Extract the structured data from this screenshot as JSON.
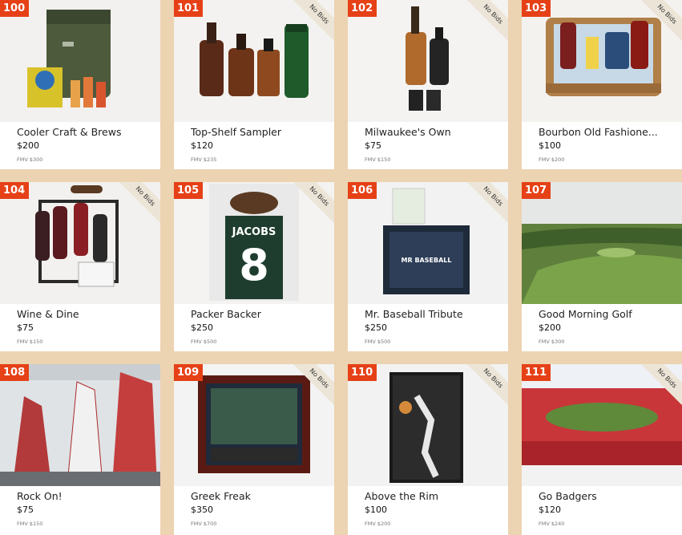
{
  "no_bids_label": "No Bids",
  "items": [
    {
      "lot": "100",
      "title": "Cooler Craft & Brews",
      "price": "$200",
      "fmv": "FMV $300",
      "no_bids": false,
      "icon": "cooler-icon"
    },
    {
      "lot": "101",
      "title": "Top-Shelf Sampler",
      "price": "$120",
      "fmv": "FMV $235",
      "no_bids": true,
      "icon": "bottles-icon"
    },
    {
      "lot": "102",
      "title": "Milwaukee's Own",
      "price": "$75",
      "fmv": "FMV $150",
      "no_bids": true,
      "icon": "bottles-icon"
    },
    {
      "lot": "103",
      "title": "Bourbon Old Fashione...",
      "price": "$100",
      "fmv": "FMV $200",
      "no_bids": true,
      "icon": "basket-icon"
    },
    {
      "lot": "104",
      "title": "Wine & Dine",
      "price": "$75",
      "fmv": "FMV $150",
      "no_bids": true,
      "icon": "wine-icon"
    },
    {
      "lot": "105",
      "title": "Packer Backer",
      "price": "$250",
      "fmv": "FMV $500",
      "no_bids": true,
      "icon": "jersey-icon"
    },
    {
      "lot": "106",
      "title": "Mr. Baseball Tribute",
      "price": "$250",
      "fmv": "FMV $500",
      "no_bids": true,
      "icon": "frame-icon"
    },
    {
      "lot": "107",
      "title": "Good Morning Golf",
      "price": "$200",
      "fmv": "FMV $300",
      "no_bids": false,
      "icon": "golf-icon"
    },
    {
      "lot": "108",
      "title": "Rock On!",
      "price": "$75",
      "fmv": "FMV $150",
      "no_bids": false,
      "icon": "climbing-icon"
    },
    {
      "lot": "109",
      "title": "Greek Freak",
      "price": "$350",
      "fmv": "FMV $700",
      "no_bids": true,
      "icon": "frame-icon"
    },
    {
      "lot": "110",
      "title": "Above the Rim",
      "price": "$100",
      "fmv": "FMV $200",
      "no_bids": true,
      "icon": "canvas-icon"
    },
    {
      "lot": "111",
      "title": "Go Badgers",
      "price": "$120",
      "fmv": "FMV $240",
      "no_bids": true,
      "icon": "stadium-icon"
    }
  ]
}
